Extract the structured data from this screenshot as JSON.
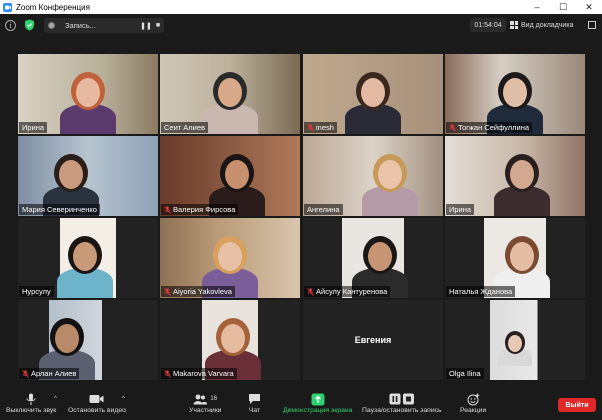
{
  "window": {
    "title": "Zoom Конференция",
    "minimize": "–",
    "maximize": "☐",
    "close": "✕"
  },
  "topbar": {
    "recording_label": "Запись...",
    "pause_symbol": "❚❚",
    "stop_symbol": "■",
    "timer": "01:54:04",
    "view_label": "Вид докладчика",
    "info_symbol": "i"
  },
  "participants": [
    {
      "name": "Ирина",
      "muted": false,
      "speaking": true
    },
    {
      "name": "Сеит Алиев",
      "muted": false,
      "speaking": false
    },
    {
      "name": "inesh",
      "muted": true,
      "speaking": false
    },
    {
      "name": "Тогжан Сейфуллина",
      "muted": true,
      "speaking": false
    },
    {
      "name": "Мария Северинченко",
      "muted": false,
      "speaking": false
    },
    {
      "name": "Валерия Фирсова",
      "muted": true,
      "speaking": false
    },
    {
      "name": "Ангелина",
      "muted": false,
      "speaking": false
    },
    {
      "name": "Ирина",
      "muted": false,
      "speaking": false
    },
    {
      "name": "Нурсулу",
      "muted": false,
      "speaking": false
    },
    {
      "name": "Aiyoria Yakovleva",
      "muted": true,
      "speaking": false
    },
    {
      "name": "Айсулу Кантуренова",
      "muted": true,
      "speaking": false
    },
    {
      "name": "Наталья Жданова",
      "muted": false,
      "speaking": false
    },
    {
      "name": "Арлан Алиев",
      "muted": true,
      "speaking": false
    },
    {
      "name": "Makarova Varvara",
      "muted": true,
      "speaking": false
    },
    {
      "name": "Евгения",
      "muted": false,
      "speaking": false,
      "video": false
    },
    {
      "name": "Olga Ilina",
      "muted": false,
      "speaking": false
    }
  ],
  "toolbar": {
    "mute_label": "Выключить звук",
    "video_label": "Остановить видео",
    "participants_label": "Участники",
    "participants_count": "16",
    "chat_label": "Чат",
    "share_label": "Демонстрация экрана",
    "record_label": "Пауза/остановить запись",
    "reactions_label": "Реакции",
    "leave_label": "Выйти",
    "caret": "^"
  },
  "colors": {
    "speaking_outline": "#c5e33c",
    "share_green": "#2dd36f",
    "leave_red": "#e02828",
    "mute_red": "#e0393e"
  }
}
